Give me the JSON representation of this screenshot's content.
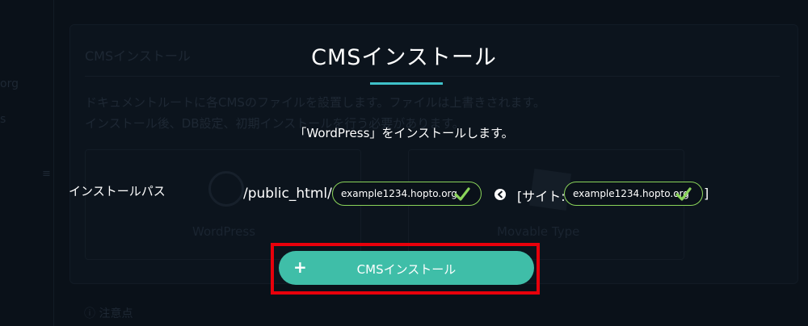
{
  "background": {
    "section_title": "CMSインストール",
    "description_lines": [
      "ドキュメントルートに各CMSのファイルを設置します。ファイルは上書きされます。",
      "インストール後、DB設定、初期インストールを行う必要があります。"
    ],
    "sidebar_fragments": [
      "org",
      "s"
    ],
    "cms_options": [
      {
        "label": "WordPress",
        "icon": "wordpress-logo-icon"
      },
      {
        "label": "Movable Type",
        "icon": "movable-type-logo-icon"
      }
    ],
    "notice_label": "注意点"
  },
  "modal": {
    "title": "CMSインストール",
    "description": "「WordPress」をインストールします。",
    "path_label": "インストールパス",
    "path_prefix": "/public_html/",
    "path_value": "example1234.hopto.org",
    "site_open": "[サイト:",
    "site_value": "example1234.hopto.org",
    "site_close": "]",
    "install_button_label": "CMSインストール",
    "install_button_icon": "plus-icon",
    "sync_icon": "arrow-left-circle-icon"
  },
  "colors": {
    "background": "#0a1119",
    "accent_underline": "#3fc1c9",
    "button": "#3fbea8",
    "input_border": "#8ad45a",
    "check": "#8ad45a",
    "highlight": "#e8000b"
  }
}
